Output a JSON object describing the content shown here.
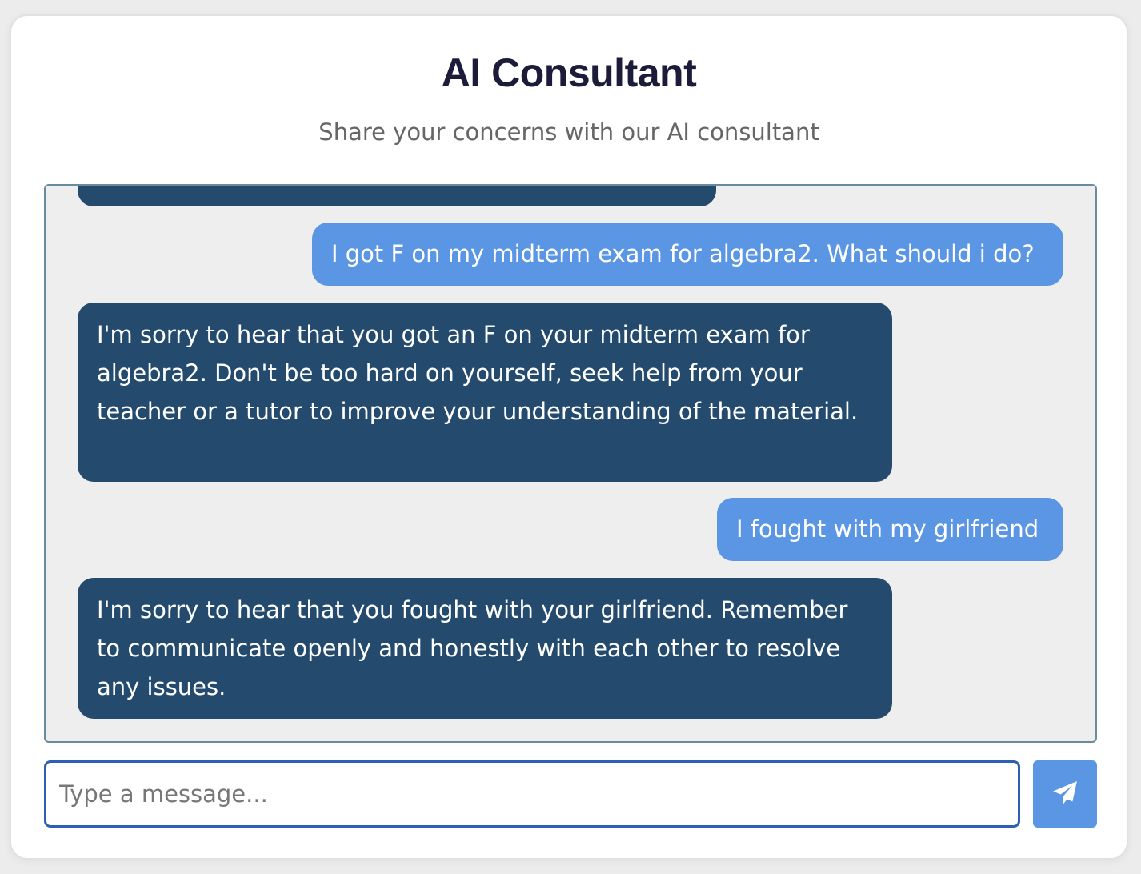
{
  "header": {
    "title": "AI Consultant",
    "subtitle": "Share your concerns with our AI consultant"
  },
  "messages": [
    {
      "role": "ai",
      "text": ""
    },
    {
      "role": "user",
      "text": "I got F on my midterm exam for algebra2. What should i do?"
    },
    {
      "role": "ai",
      "text": "I'm sorry to hear that you got an F on your midterm exam for algebra2. Don't be too hard on yourself, seek help from your teacher or a tutor to improve your understanding of the material."
    },
    {
      "role": "user",
      "text": "I fought with my girlfriend"
    },
    {
      "role": "ai",
      "text": "I'm sorry to hear that you fought with your girlfriend. Remember to communicate openly and honestly with each other to resolve any issues."
    }
  ],
  "composer": {
    "placeholder": "Type a message...",
    "value": "",
    "send_icon": "paper-plane-icon"
  },
  "colors": {
    "ai_bubble": "#244b6e",
    "user_bubble": "#5a96e4",
    "input_border": "#2e5fb0",
    "title": "#1c1c3a"
  }
}
